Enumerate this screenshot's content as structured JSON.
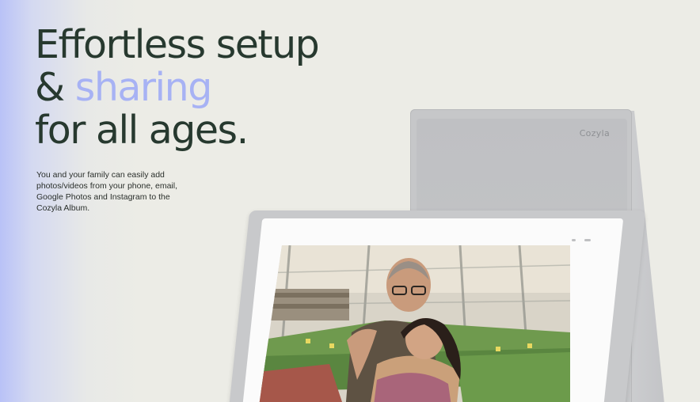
{
  "hero": {
    "line1": "Effortless setup",
    "amp": "&",
    "accent_word": "sharing",
    "line3": "for all ages.",
    "body": "You and your family can easily add photos/videos from your phone, email, Google Photos and Instagram to the Cozyla Album."
  },
  "device": {
    "brand": "Cozyla"
  },
  "colors": {
    "headline": "#27392f",
    "accent": "#a7b2f4",
    "background": "#ecece6"
  }
}
